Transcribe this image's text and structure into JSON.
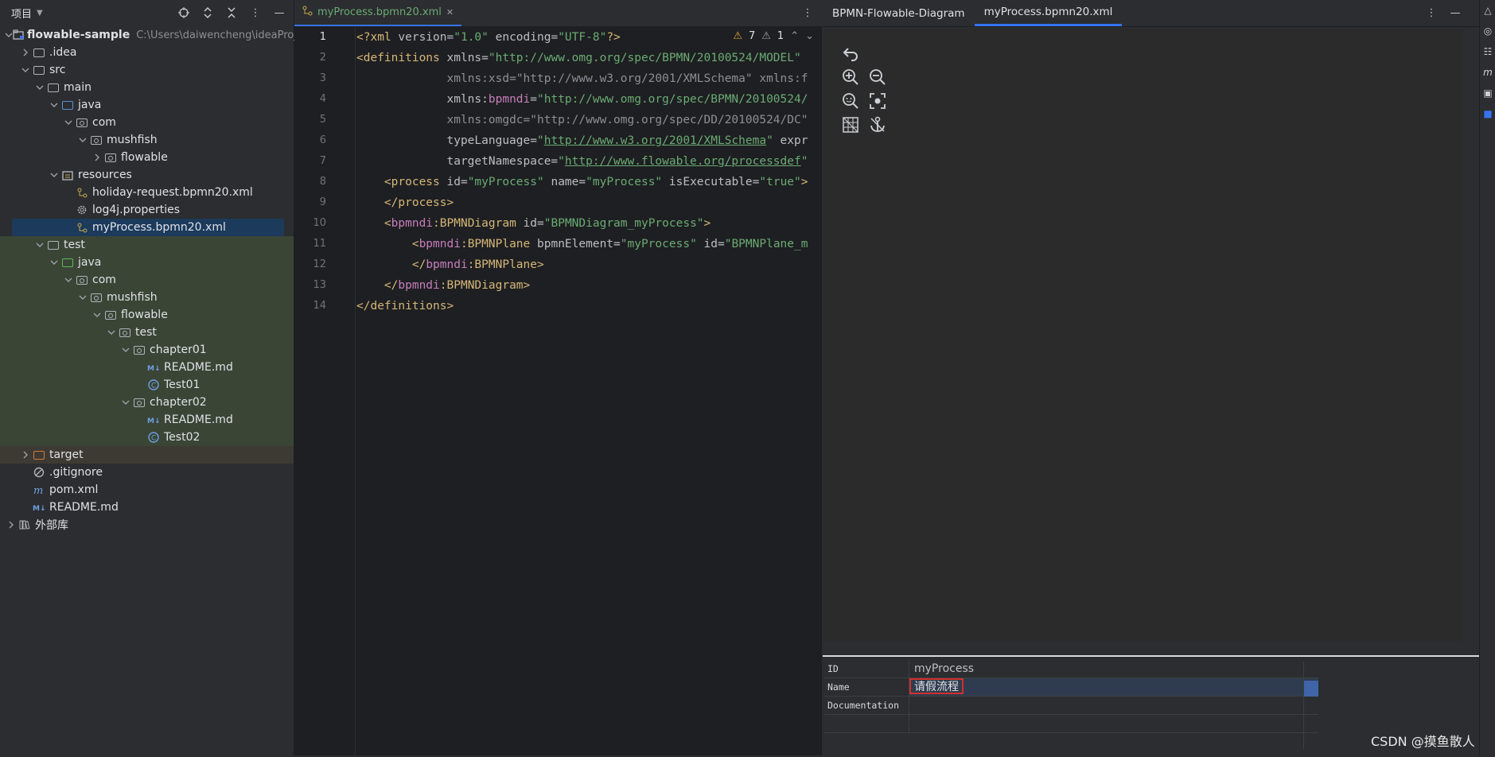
{
  "project_panel": {
    "title": "项目",
    "tree": [
      {
        "label": "flowable-sample",
        "path": "C:\\Users\\daiwencheng\\ideaProj",
        "indent": 0,
        "chev": "v",
        "icon": "module",
        "style": "bold"
      },
      {
        "label": ".idea",
        "indent": 1,
        "chev": ">",
        "icon": "folder",
        "color": "c-yellow"
      },
      {
        "label": "src",
        "indent": 1,
        "chev": "v",
        "icon": "folder"
      },
      {
        "label": "main",
        "indent": 2,
        "chev": "v",
        "icon": "folder"
      },
      {
        "label": "java",
        "indent": 3,
        "chev": "v",
        "icon": "folder-blue"
      },
      {
        "label": "com",
        "indent": 4,
        "chev": "v",
        "icon": "pkg"
      },
      {
        "label": "mushfish",
        "indent": 5,
        "chev": "v",
        "icon": "pkg"
      },
      {
        "label": "flowable",
        "indent": 6,
        "chev": ">",
        "icon": "pkg"
      },
      {
        "label": "resources",
        "indent": 3,
        "chev": "v",
        "icon": "folder-res"
      },
      {
        "label": "holiday-request.bpmn20.xml",
        "indent": 4,
        "chev": "",
        "icon": "bpmn",
        "color": "c-blue"
      },
      {
        "label": "log4j.properties",
        "indent": 4,
        "chev": "",
        "icon": "gear"
      },
      {
        "label": "myProcess.bpmn20.xml",
        "indent": 4,
        "chev": "",
        "icon": "bpmn",
        "color": "c-green",
        "selected": true
      },
      {
        "label": "test",
        "indent": 2,
        "chev": "v",
        "icon": "folder",
        "bg": "test-bg"
      },
      {
        "label": "java",
        "indent": 3,
        "chev": "v",
        "icon": "folder-green",
        "bg": "test-bg"
      },
      {
        "label": "com",
        "indent": 4,
        "chev": "v",
        "icon": "pkg",
        "bg": "test-bg"
      },
      {
        "label": "mushfish",
        "indent": 5,
        "chev": "v",
        "icon": "pkg",
        "bg": "test-bg"
      },
      {
        "label": "flowable",
        "indent": 6,
        "chev": "v",
        "icon": "pkg",
        "bg": "test-bg"
      },
      {
        "label": "test",
        "indent": 7,
        "chev": "v",
        "icon": "pkg",
        "bg": "test-bg"
      },
      {
        "label": "chapter01",
        "indent": 8,
        "chev": "v",
        "icon": "pkg",
        "bg": "test-bg"
      },
      {
        "label": "README.md",
        "indent": 9,
        "chev": "",
        "icon": "md",
        "color": "c-blue",
        "bg": "test-bg"
      },
      {
        "label": "Test01",
        "indent": 9,
        "chev": "",
        "icon": "class",
        "color": "c-blue",
        "bg": "test-bg"
      },
      {
        "label": "chapter02",
        "indent": 8,
        "chev": "v",
        "icon": "pkg",
        "bg": "test-bg"
      },
      {
        "label": "README.md",
        "indent": 9,
        "chev": "",
        "icon": "md",
        "color": "c-green",
        "bg": "test-bg"
      },
      {
        "label": "Test02",
        "indent": 9,
        "chev": "",
        "icon": "class",
        "color": "c-green",
        "bg": "test-bg"
      },
      {
        "label": "target",
        "indent": 1,
        "chev": ">",
        "icon": "folder-orange",
        "color": "c-orange",
        "bg": "target-bg"
      },
      {
        "label": ".gitignore",
        "indent": 1,
        "chev": "",
        "icon": "ignore"
      },
      {
        "label": "pom.xml",
        "indent": 1,
        "chev": "",
        "icon": "maven"
      },
      {
        "label": "README.md",
        "indent": 1,
        "chev": "",
        "icon": "md",
        "color": "c-blue"
      },
      {
        "label": "外部库",
        "indent": 0,
        "chev": ">",
        "icon": "lib"
      }
    ]
  },
  "editor": {
    "tab_label": "myProcess.bpmn20.xml",
    "inspection": {
      "warnings": "7",
      "weak_warnings": "1"
    },
    "current_line": 1,
    "lines": [
      [
        [
          "tag",
          "<?xml "
        ],
        [
          "attr",
          "version="
        ],
        [
          "str",
          "\"1.0\""
        ],
        [
          "attr",
          " encoding="
        ],
        [
          "str",
          "\"UTF-8\""
        ],
        [
          "tag",
          "?>"
        ]
      ],
      [
        [
          "tag",
          "<definitions "
        ],
        [
          "attr",
          "xmlns="
        ],
        [
          "str",
          "\"http://www.omg.org/spec/BPMN/20100524/MODEL\""
        ]
      ],
      [
        [
          "attr",
          "             "
        ],
        [
          "dim",
          "xmlns:xsd="
        ],
        [
          "dim",
          "\"http://www.w3.org/2001/XMLSchema\" xmlns:f"
        ]
      ],
      [
        [
          "attr",
          "             xmlns:"
        ],
        [
          "ns",
          "bpmndi"
        ],
        [
          "attr",
          "="
        ],
        [
          "str",
          "\"http://www.omg.org/spec/BPMN/20100524/"
        ]
      ],
      [
        [
          "attr",
          "             "
        ],
        [
          "dim",
          "xmlns:omgdc="
        ],
        [
          "dim",
          "\"http://www.omg.org/spec/DD/20100524/DC\""
        ]
      ],
      [
        [
          "attr",
          "             typeLanguage="
        ],
        [
          "str",
          "\""
        ],
        [
          "strU",
          "http://www.w3.org/2001/XMLSchema"
        ],
        [
          "str",
          "\""
        ],
        [
          "attr",
          " expr"
        ]
      ],
      [
        [
          "attr",
          "             targetNamespace="
        ],
        [
          "str",
          "\""
        ],
        [
          "strU",
          "http://www.flowable.org/processdef"
        ],
        [
          "str",
          "\""
        ]
      ],
      [
        [
          "attr",
          "    "
        ],
        [
          "tag",
          "<process "
        ],
        [
          "attr",
          "id="
        ],
        [
          "str",
          "\"myProcess\""
        ],
        [
          "attr",
          " name="
        ],
        [
          "str",
          "\"myProcess\""
        ],
        [
          "attr",
          " isExecutable="
        ],
        [
          "str",
          "\"true\""
        ],
        [
          "tag",
          ">"
        ]
      ],
      [
        [
          "attr",
          "    "
        ],
        [
          "tag",
          "</process>"
        ]
      ],
      [
        [
          "attr",
          "    "
        ],
        [
          "tag",
          "<"
        ],
        [
          "ns",
          "bpmndi"
        ],
        [
          "tag",
          ":BPMNDiagram "
        ],
        [
          "attr",
          "id="
        ],
        [
          "str",
          "\"BPMNDiagram_myProcess\""
        ],
        [
          "tag",
          ">"
        ]
      ],
      [
        [
          "attr",
          "        "
        ],
        [
          "tag",
          "<"
        ],
        [
          "ns",
          "bpmndi"
        ],
        [
          "tag",
          ":BPMNPlane "
        ],
        [
          "attr",
          "bpmnElement="
        ],
        [
          "str",
          "\"myProcess\""
        ],
        [
          "attr",
          " id="
        ],
        [
          "str",
          "\"BPMNPlane_m"
        ]
      ],
      [
        [
          "attr",
          "        "
        ],
        [
          "tag",
          "</"
        ],
        [
          "ns",
          "bpmndi"
        ],
        [
          "tag",
          ":BPMNPlane>"
        ]
      ],
      [
        [
          "attr",
          "    "
        ],
        [
          "tag",
          "</"
        ],
        [
          "ns",
          "bpmndi"
        ],
        [
          "tag",
          ":BPMNDiagram>"
        ]
      ],
      [
        [
          "tag",
          "</definitions>"
        ]
      ]
    ]
  },
  "designer": {
    "tabs": [
      "BPMN-Flowable-Diagram",
      "myProcess.bpmn20.xml"
    ],
    "active_tab": 1,
    "palette": [
      "undo-icon",
      "",
      "zoom-in-icon",
      "zoom-out-icon",
      "zoom-reset-icon",
      "fit-icon",
      "grid-icon",
      "anchor-icon"
    ],
    "properties": [
      {
        "key": "ID",
        "value": "myProcess"
      },
      {
        "key": "Name",
        "value": "请假流程",
        "editing": true
      },
      {
        "key": "Documentation",
        "value": ""
      },
      {
        "key": "",
        "value": ""
      }
    ]
  },
  "watermark": "CSDN @摸鱼散人"
}
